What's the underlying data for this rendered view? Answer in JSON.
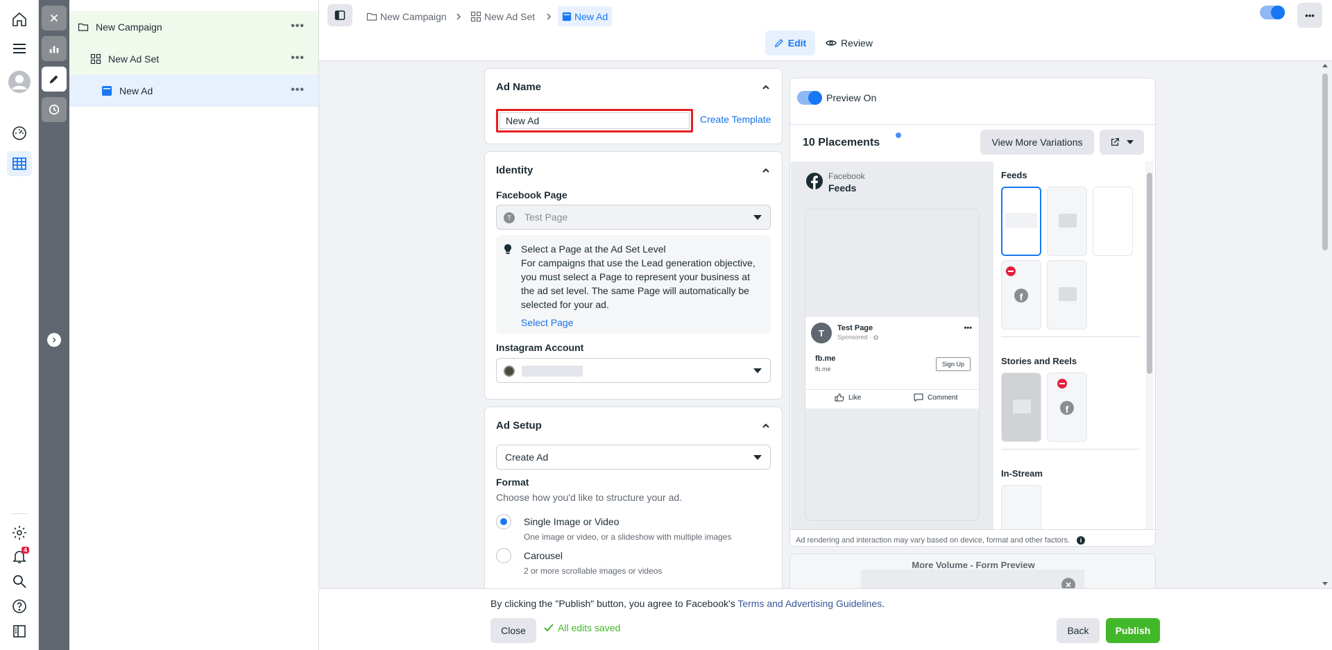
{
  "tree": {
    "campaign": "New Campaign",
    "ad_set": "New Ad Set",
    "ad": "New Ad",
    "more": "•••"
  },
  "nav": {
    "notifications_count": "4"
  },
  "breadcrumb": [
    "New Campaign",
    "New Ad Set",
    "New Ad"
  ],
  "mode_tabs": {
    "edit": "Edit",
    "review": "Review"
  },
  "top_more": "•••",
  "ad_name": {
    "title": "Ad Name",
    "value": "New Ad",
    "create_template": "Create Template"
  },
  "identity": {
    "title": "Identity",
    "facebook_page_label": "Facebook Page",
    "facebook_page_value": "Test Page",
    "page_avatar_letter": "T",
    "notice_title": "Select a Page at the Ad Set Level",
    "notice_line1": "For campaigns that use the Lead generation objective,",
    "notice_line2": "you must select a Page to represent your business at",
    "notice_line3": "the ad set level. The same Page will automatically be",
    "notice_line4": "selected for your ad.",
    "select_page": "Select Page",
    "instagram_label": "Instagram Account"
  },
  "ad_setup": {
    "title": "Ad Setup",
    "create_value": "Create Ad",
    "format_label": "Format",
    "format_help": "Choose how you'd like to structure your ad.",
    "options": [
      {
        "title": "Single Image or Video",
        "desc": "One image or video, or a slideshow with multiple images",
        "selected": true
      },
      {
        "title": "Carousel",
        "desc": "2 or more scrollable images or videos",
        "selected": false
      }
    ]
  },
  "preview": {
    "toggle_label": "Preview On",
    "placements_title": "10 Placements",
    "view_more": "View More Variations",
    "platform": "Facebook",
    "placement": "Feeds",
    "post": {
      "page_letter": "T",
      "page_name": "Test Page",
      "sponsored": "Sponsored · ",
      "headline": "fb.me",
      "link": "fb.me",
      "cta": "Sign Up",
      "like": "Like",
      "comment": "Comment",
      "more": "•••"
    },
    "sections": {
      "feeds": "Feeds",
      "stories": "Stories and Reels",
      "instream": "In-Stream"
    },
    "disclaimer": "Ad rendering and interaction may vary based on device, format and other factors.",
    "form_preview": "More Volume - Form Preview"
  },
  "footer": {
    "agree_prefix": "By clicking the \"Publish\" button, you agree to Facebook's ",
    "terms_link": "Terms and Advertising Guidelines",
    "agree_suffix": ".",
    "close": "Close",
    "saved": "All edits saved",
    "back": "Back",
    "publish": "Publish"
  },
  "colors": {
    "accent": "#1877f2",
    "publish": "#42b72a",
    "highlight_border": "#e41e1e"
  }
}
